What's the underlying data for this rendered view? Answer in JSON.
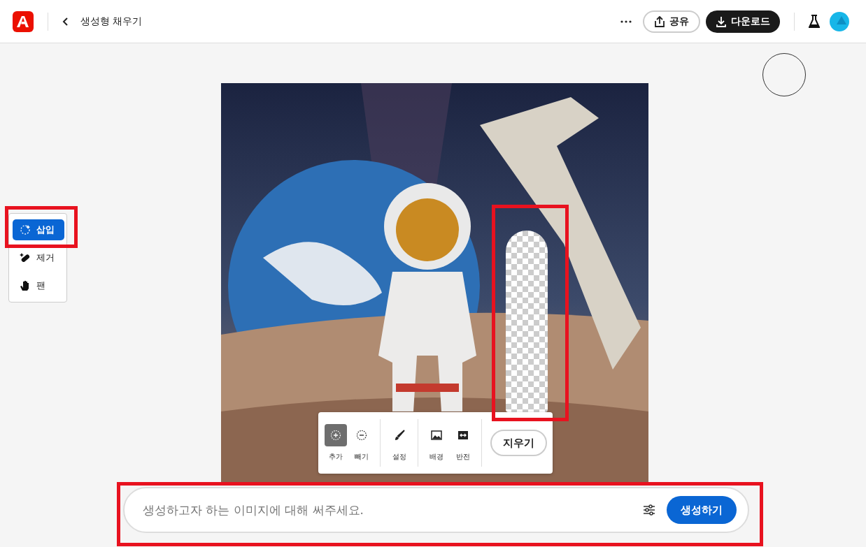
{
  "header": {
    "title": "생성형 채우기",
    "share": "공유",
    "download": "다운로드"
  },
  "tools": [
    {
      "label": "삽입",
      "selected": true
    },
    {
      "label": "제거",
      "selected": false
    },
    {
      "label": "팬",
      "selected": false
    }
  ],
  "brush_toolbar": {
    "groups": [
      [
        {
          "label": "추가",
          "selected": true
        },
        {
          "label": "빼기",
          "selected": false
        }
      ],
      [
        {
          "label": "설정",
          "selected": false
        }
      ],
      [
        {
          "label": "배경",
          "selected": false
        },
        {
          "label": "반전",
          "selected": false
        }
      ]
    ],
    "clear": "지우기"
  },
  "prompt": {
    "placeholder": "생성하고자 하는 이미지에 대해 써주세요.",
    "generate": "생성하기"
  }
}
